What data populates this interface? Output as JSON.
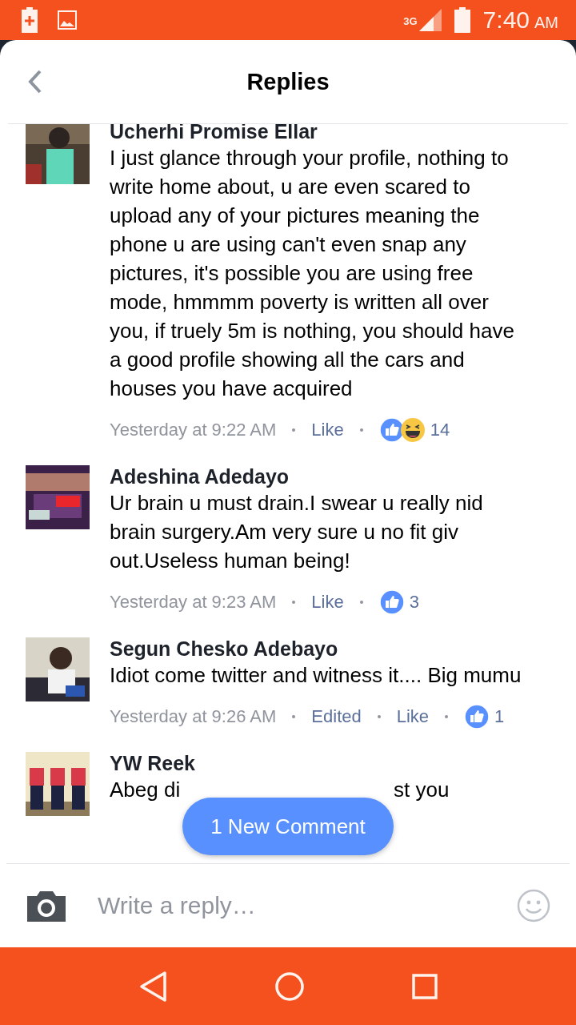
{
  "status_bar": {
    "network": "3G",
    "time": "7:40",
    "ampm": "AM"
  },
  "header": {
    "title": "Replies"
  },
  "comments": [
    {
      "author": "Ucherhi Promise Ellar",
      "body": [
        "I just glance through your profile, nothing to write home about, u are even scared to upload any of your pictures meaning the phone u are using can't even snap any pictures, it's possible you are using free mode, hmmmm poverty is written all over you, if truely 5m is nothing, you should have a good profile showing all the cars and houses you have acquired"
      ],
      "time": "Yesterday at 9:22 AM",
      "like": "Like",
      "reactions": [
        {
          "kind": "like"
        },
        {
          "kind": "haha"
        }
      ],
      "count": "14"
    },
    {
      "author": "Adeshina Adedayo",
      "body": [
        "Ur brain u must drain.I swear u really nid brain surgery.Am very sure u no fit giv out.Useless human being!"
      ],
      "time": "Yesterday at 9:23 AM",
      "like": "Like",
      "reactions": [
        {
          "kind": "like"
        }
      ],
      "count": "3"
    },
    {
      "author": "Segun Chesko Adebayo",
      "body": [
        "Idiot come twitter and witness it.... Big mumu"
      ],
      "time": "Yesterday at 9:26 AM",
      "edited": "Edited",
      "like": "Like",
      "reactions": [
        {
          "kind": "like"
        }
      ],
      "count": "1"
    },
    {
      "author": "YW Reek",
      "body": [
        "Abeg di",
        "st you"
      ]
    }
  ],
  "new_comment_pill": {
    "label": "1 New Comment"
  },
  "composer": {
    "placeholder": "Write a reply…"
  }
}
